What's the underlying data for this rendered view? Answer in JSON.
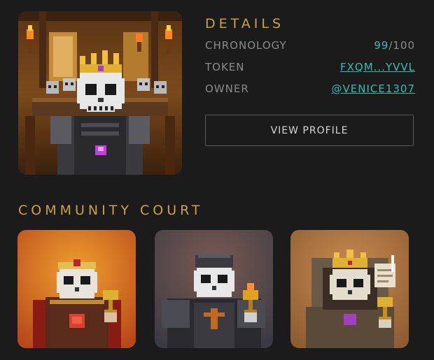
{
  "details": {
    "title": "DETAILS",
    "chronology": {
      "label": "CHRONOLOGY",
      "score": "99",
      "max": "/100"
    },
    "token": {
      "label": "TOKEN",
      "value": "FXQM...YVVL"
    },
    "owner": {
      "label": "OWNER",
      "value": "@VENICE1307"
    }
  },
  "actions": {
    "view_profile": "VIEW PROFILE"
  },
  "community": {
    "title": "COMMUNITY COURT"
  },
  "colors": {
    "gold": "#c9a24a",
    "teal": "#35bdb2",
    "background": "#1b1b1b"
  }
}
